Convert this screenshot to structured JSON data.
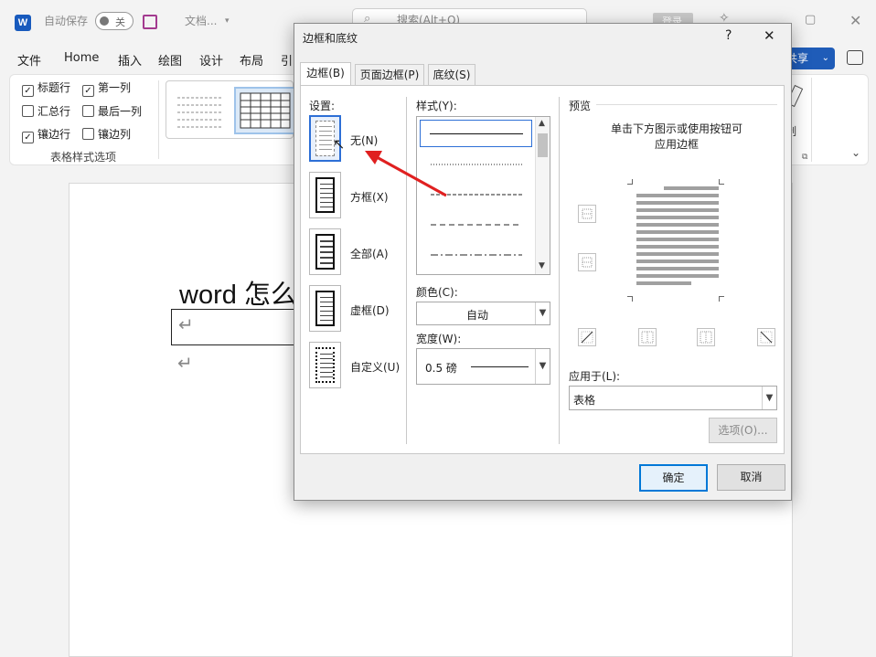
{
  "titlebar": {
    "app_icon": "W",
    "autosave_label": "自动保存",
    "autosave_state": "关",
    "doc_name": "文档...",
    "search_placeholder": "搜索(Alt+Q)",
    "login_label": "登录"
  },
  "menu": {
    "items": [
      "文件",
      "Home",
      "插入",
      "绘图",
      "设计",
      "布局",
      "引"
    ],
    "share_label": "共享"
  },
  "ribbon": {
    "options": [
      {
        "label": "标题行",
        "checked": true
      },
      {
        "label": "第一列",
        "checked": true
      },
      {
        "label": "汇总行",
        "checked": false
      },
      {
        "label": "最后一列",
        "checked": false
      },
      {
        "label": "镶边行",
        "checked": true
      },
      {
        "label": "镶边列",
        "checked": false
      }
    ],
    "group_label": "表格样式选项",
    "right_partial": "制"
  },
  "document": {
    "title_text": "word 怎么",
    "return_mark": "↵"
  },
  "dialog": {
    "title": "边框和底纹",
    "help": "?",
    "close": "✕",
    "tabs": [
      "边框(B)",
      "页面边框(P)",
      "底纹(S)"
    ],
    "active_tab": 0,
    "setting_label": "设置:",
    "settings": [
      {
        "label": "无(N)",
        "selected": true
      },
      {
        "label": "方框(X)",
        "selected": false
      },
      {
        "label": "全部(A)",
        "selected": false
      },
      {
        "label": "虚框(D)",
        "selected": false
      },
      {
        "label": "自定义(U)",
        "selected": false
      }
    ],
    "style_label": "样式(Y):",
    "color_label": "颜色(C):",
    "color_value": "自动",
    "width_label": "宽度(W):",
    "width_value": "0.5 磅",
    "preview_label": "预览",
    "preview_hint_1": "单击下方图示或使用按钮可",
    "preview_hint_2": "应用边框",
    "apply_label": "应用于(L):",
    "apply_value": "表格",
    "options_button": "选项(O)...",
    "ok_button": "确定",
    "cancel_button": "取消"
  },
  "colors": {
    "accent": "#1f5cb8",
    "dialog_focus": "#0078d7",
    "annotation_arrow": "#e02020"
  }
}
